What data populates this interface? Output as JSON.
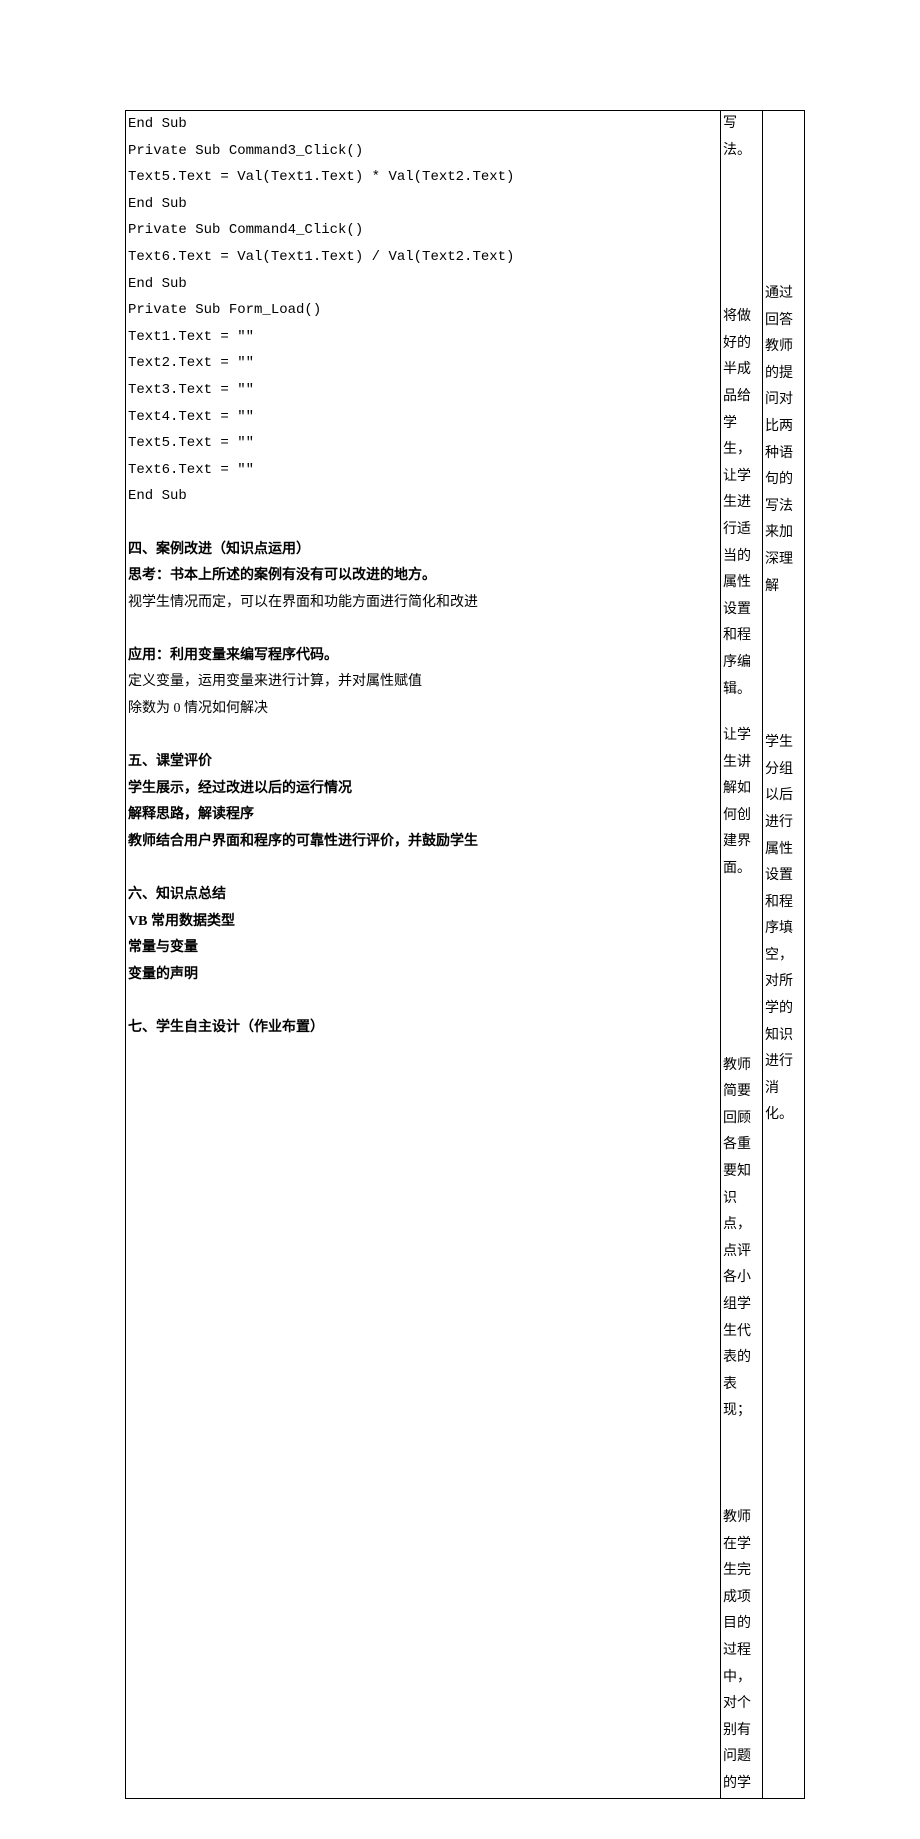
{
  "left": {
    "code": [
      "End Sub",
      "Private Sub Command3_Click()",
      "Text5.Text = Val(Text1.Text) * Val(Text2.Text)",
      "End Sub",
      "Private Sub Command4_Click()",
      "Text6.Text = Val(Text1.Text) / Val(Text2.Text)",
      "End Sub",
      "Private Sub Form_Load()",
      "Text1.Text = \"\"",
      "Text2.Text = \"\"",
      "Text3.Text = \"\"",
      "Text4.Text = \"\"",
      "Text5.Text = \"\"",
      "Text6.Text = \"\"",
      "End Sub"
    ],
    "s4_title": "四、案例改进（知识点运用）",
    "s4_think": "思考：书本上所述的案例有没有可以改进的地方。",
    "s4_note": "视学生情况而定，可以在界面和功能方面进行简化和改进",
    "s4_apply_title": "应用：利用变量来编写程序代码。",
    "s4_apply_l1": "定义变量，运用变量来进行计算，并对属性赋值",
    "s4_apply_l2": "除数为 0 情况如何解决",
    "s5_title": "五、课堂评价",
    "s5_l1": "学生展示，经过改进以后的运行情况",
    "s5_l2": "解释思路，解读程序",
    "s5_l3": "教师结合用户界面和程序的可靠性进行评价，并鼓励学生",
    "s6_title": "六、知识点总结",
    "s6_l1": "VB 常用数据类型",
    "s6_l2": "常量与变量",
    "s6_l3": "变量的声明",
    "s7_title": "七、学生自主设计（作业布置）"
  },
  "mid": {
    "p1": "写法。",
    "p2": "将做好的半成品给学生，让学生进行适当的属性设置和程序编辑。",
    "p3": "让学生讲解如何创建界面。",
    "p4": "教师简要回顾各重要知识点，点评各小组学生代表的表现；",
    "p5": "教师在学生完成项目的过程中，对个别有问题的学"
  },
  "right": {
    "p1": "通过回答教师的提问对比两种语句的写法来加深理解",
    "p2": "学生分组以后进行属性设置和程序填空，对所学的知识进行消化。"
  }
}
